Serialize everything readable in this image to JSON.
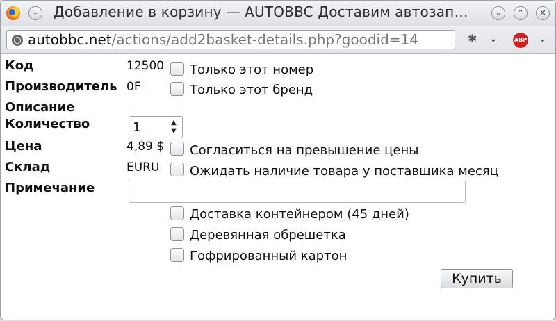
{
  "window": {
    "title": "Добавление в корзину — AUTOBBC Доставим автозап…",
    "url_host": "autobbc.net",
    "url_path": "/actions/add2basket-details.php?goodid=14"
  },
  "form": {
    "code_label": "Код",
    "code_value": "12500",
    "maker_label": "Производитель",
    "maker_value": "0F",
    "desc_label": "Описание",
    "qty_label": "Количество",
    "qty_value": "1",
    "price_label": "Цена",
    "price_value": "4,89 $",
    "stock_label": "Склад",
    "stock_value": "EURU",
    "note_label": "Примечание",
    "note_value": ""
  },
  "options": [
    {
      "label": "Только этот номер",
      "checked": false
    },
    {
      "label": "Только этот бренд",
      "checked": false
    },
    {
      "label": "Согласиться на превышение цены",
      "checked": false
    },
    {
      "label": "Ожидать наличие товара у поставщика месяц",
      "checked": false
    },
    {
      "label": "Доставка контейнером (45 дней)",
      "checked": false
    },
    {
      "label": "Деревянная обрешетка",
      "checked": false
    },
    {
      "label": "Гофрированный картон",
      "checked": false
    }
  ],
  "buy_label": "Купить",
  "icons": {
    "browser": "firefox-icon",
    "site": "globe-icon",
    "addon": "bug-icon",
    "adblock": "adblock-plus-icon",
    "adblock_text": "ABP"
  }
}
